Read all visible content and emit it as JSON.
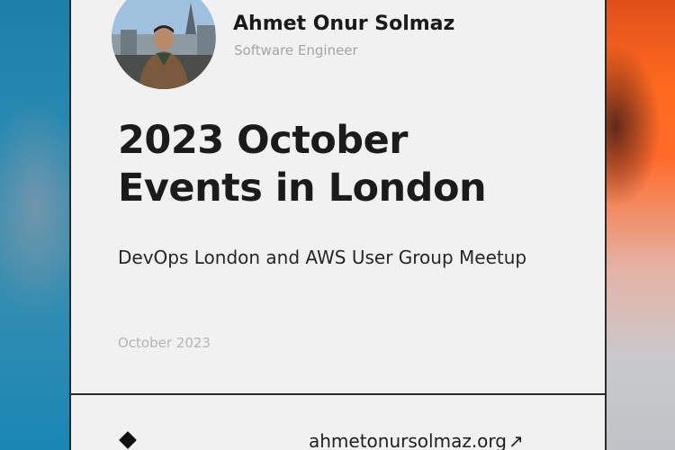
{
  "author": {
    "name": "Ahmet Onur Solmaz",
    "role": "Software Engineer"
  },
  "post": {
    "title_line1": "2023 October",
    "title_line2": "Events in London",
    "subtitle": "DevOps London and AWS User Group Meetup",
    "date": "October 2023"
  },
  "footer": {
    "site": "ahmetonursolmaz.org",
    "arrow": "↗"
  },
  "colors": {
    "card_bg": "#f1f1f1",
    "text": "#1b1b1b",
    "muted": "#a5a5a5",
    "left_accent": "#1d7fa8",
    "right_accent": "#ff6a1e"
  },
  "icons": {
    "footer_mark": "diamond-icon",
    "external_link": "arrow-up-right-icon"
  }
}
